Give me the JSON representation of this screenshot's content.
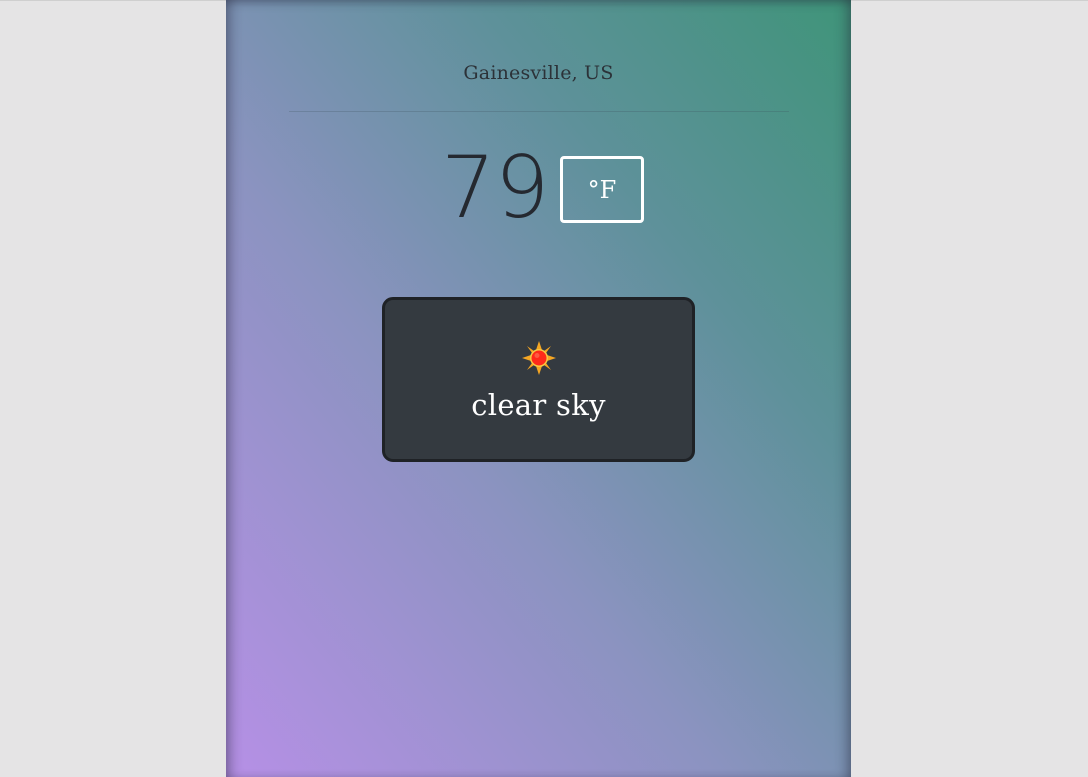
{
  "location": "Gainesville, US",
  "temperature": "79",
  "unit_label": "°F",
  "weather": {
    "icon": "sun-icon",
    "description": "clear sky"
  },
  "colors": {
    "background": "#e5e4e5",
    "gradient_bottom_left": "#b690e6",
    "gradient_top_right": "#3f9479",
    "card": "#343a40",
    "text_dark": "#252930"
  }
}
